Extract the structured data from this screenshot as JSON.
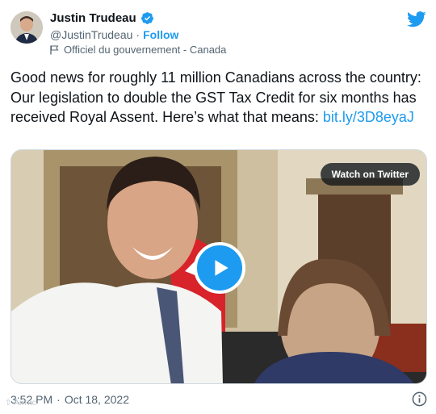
{
  "tweet": {
    "display_name": "Justin Trudeau",
    "handle": "@JustinTrudeau",
    "separator": "·",
    "follow_label": "Follow",
    "affiliation_label": "Officiel du gouvernement - Canada",
    "text_main": "Good news for roughly 11 million Canadians across the country: Our legislation to double the GST Tax Credit for six months has received Royal Assent. Here’s what that means: ",
    "link_text": "bit.ly/3D8eyaJ",
    "time": "3:52 PM",
    "date": "Oct 18, 2022",
    "watermark_text": "⇧ Аитис"
  },
  "media": {
    "watch_label": "Watch on Twitter"
  },
  "icons": {
    "verified": "verified-badge-icon",
    "twitter": "twitter-bird-icon",
    "flag": "flag-icon",
    "info": "info-icon",
    "play": "play-icon"
  },
  "colors": {
    "accent": "#1d9bf0",
    "text": "#0f1419",
    "secondary": "#536471"
  }
}
